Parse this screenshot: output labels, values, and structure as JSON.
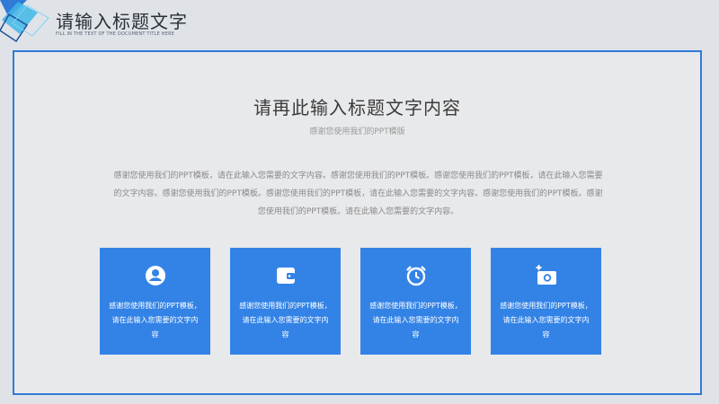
{
  "header": {
    "title": "请输入标题文字",
    "subtitle": "FILL IN THE TEXT OF THE DOCUMENT TITLE HERE"
  },
  "main": {
    "title": "请再此输入标题文字内容",
    "subtitle": "感谢您使用我们的PPT模版",
    "body": "感谢您使用我们的PPT模板，请在此输入您需要的文字内容。感谢您使用我们的PPT模板。感谢您使用我们的PPT模板，请在此输入您需要的文字内容。感谢您使用我们的PPT模板。感谢您使用我们的PPT模板，请在此输入您需要的文字内容。感谢您使用我们的PPT模板。感谢您使用我们的PPT模板。请在此输入您需要的文字内容。"
  },
  "cards": [
    {
      "icon": "user-icon",
      "text": "感谢您使用我们的PPT模板，请在此输入您需要的文字内容"
    },
    {
      "icon": "wallet-icon",
      "text": "感谢您使用我们的PPT模板，请在此输入您需要的文字内容"
    },
    {
      "icon": "alarm-clock-icon",
      "text": "感谢您使用我们的PPT模板，请在此输入您需要的文字内容"
    },
    {
      "icon": "add-camera-icon",
      "text": "感谢您使用我们的PPT模板，请在此输入您需要的文字内容"
    }
  ],
  "colors": {
    "accent": "#3383e6",
    "frame": "#2f7bd6",
    "background": "#dfe3e8"
  }
}
